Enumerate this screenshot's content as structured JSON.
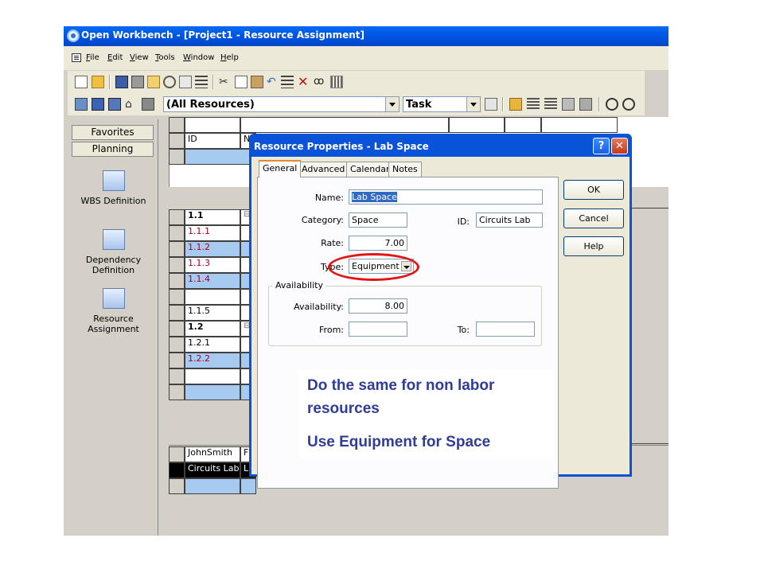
{
  "window": {
    "title": "Open Workbench - [Project1 - Resource Assignment]"
  },
  "menu": {
    "items": [
      "File",
      "Edit",
      "View",
      "Tools",
      "Window",
      "Help"
    ]
  },
  "toolbar": {
    "resource_filter": "(All Resources)",
    "view_select": "Task"
  },
  "sidebar": {
    "tabs": [
      "Favorites",
      "Planning"
    ],
    "tools": [
      {
        "label_lines": [
          "WBS Definition"
        ],
        "icon": "wbs-icon"
      },
      {
        "label_lines": [
          "Dependency",
          "Definition"
        ],
        "icon": "dependency-icon"
      },
      {
        "label_lines": [
          "Resource",
          "Assignment"
        ],
        "icon": "resource-icon"
      }
    ]
  },
  "grid": {
    "top_header": {
      "id": "ID",
      "name": "N"
    },
    "rows": [
      {
        "id": "1.1",
        "style": "bold",
        "marker": "⊟"
      },
      {
        "id": "1.1.1",
        "style": "red"
      },
      {
        "id": "1.1.2",
        "style": "red",
        "blue": true
      },
      {
        "id": "1.1.3",
        "style": "red"
      },
      {
        "id": "1.1.4",
        "style": "red",
        "blue": true
      },
      {
        "id": "",
        "style": ""
      },
      {
        "id": "1.1.5",
        "style": ""
      },
      {
        "id": "1.2",
        "style": "bold",
        "marker": "⊟"
      },
      {
        "id": "1.2.1",
        "style": ""
      },
      {
        "id": "1.2.2",
        "style": "red",
        "blue": true
      },
      {
        "id": "",
        "style": ""
      },
      {
        "id": "",
        "style": "",
        "blue": true
      }
    ],
    "resources": [
      {
        "id": "JohnSmith",
        "name": "F"
      },
      {
        "id": "Circuits Lab",
        "name": "L",
        "selected": true
      },
      {
        "id": "",
        "name": ""
      }
    ]
  },
  "dialog": {
    "title": "Resource Properties - Lab Space",
    "tabs": [
      "General",
      "Advanced",
      "Calendar",
      "Notes"
    ],
    "active_tab": "General",
    "fields": {
      "name_label": "Name:",
      "name_value": "Lab Space",
      "category_label": "Category:",
      "category_value": "Space",
      "id_label": "ID:",
      "id_value": "Circuits Lab",
      "rate_label": "Rate:",
      "rate_value": "7.00",
      "type_label": "Type:",
      "type_value": "Equipment"
    },
    "availability": {
      "group_title": "Availability",
      "label": "Availability:",
      "value": "8.00",
      "from_label": "From:",
      "from_value": "",
      "to_label": "To:",
      "to_value": ""
    },
    "buttons": {
      "ok": "OK",
      "cancel": "Cancel",
      "help": "Help"
    },
    "caption_help": "?",
    "caption_close": "✕"
  },
  "callout": {
    "line1": "Do the same for non labor",
    "line2": "resources",
    "line3": "Use Equipment for Space"
  },
  "colors": {
    "title_blue": "#0058e6",
    "callout_text": "#2f3d96",
    "highlight_red": "#e31414",
    "grid_blue": "#a6caf0"
  }
}
